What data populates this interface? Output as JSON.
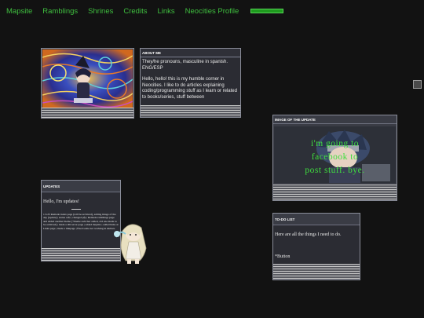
{
  "nav": {
    "items": [
      "Mapsite",
      "Ramblings",
      "Shrines",
      "Credits",
      "Links",
      "Neocities Profile"
    ]
  },
  "about": {
    "title": "ABOUT ME",
    "line1": "They/he pronouns, masculine in spanish. ENG/ESP",
    "line2": "Hello, hello! this is my humble corner in Neocities. I like to do articles explaining coding/programming stuff as I learn or related to books/series, stuff between"
  },
  "image_update": {
    "title": "IMAGE OF THE UPDATE",
    "caption_line1": "i'm going to",
    "caption_line2": "facebook to",
    "caption_line3": "post stuff. bye."
  },
  "updates": {
    "title": "UPDATES",
    "hello": "Hello, I'm updates!",
    "log": "1.3.25 Remade index page (will be archived), adding image of the day (update) | status cafe | changed pfp | Remade ramblings page and added another theme (+theme switcher added, old one made to be archived) | made a 404 error page | added mapsite | added links at Links page | made a linkpage | fixed some not working in shrines."
  },
  "todo": {
    "title": "TO-DO LIST",
    "line1": "Here are all the things I need to do.",
    "line2": "*Button"
  },
  "colors": {
    "background": "#121212",
    "nav_link": "#3fbf3f",
    "window": "#3a3c45",
    "caption": "#3fdf3f"
  }
}
